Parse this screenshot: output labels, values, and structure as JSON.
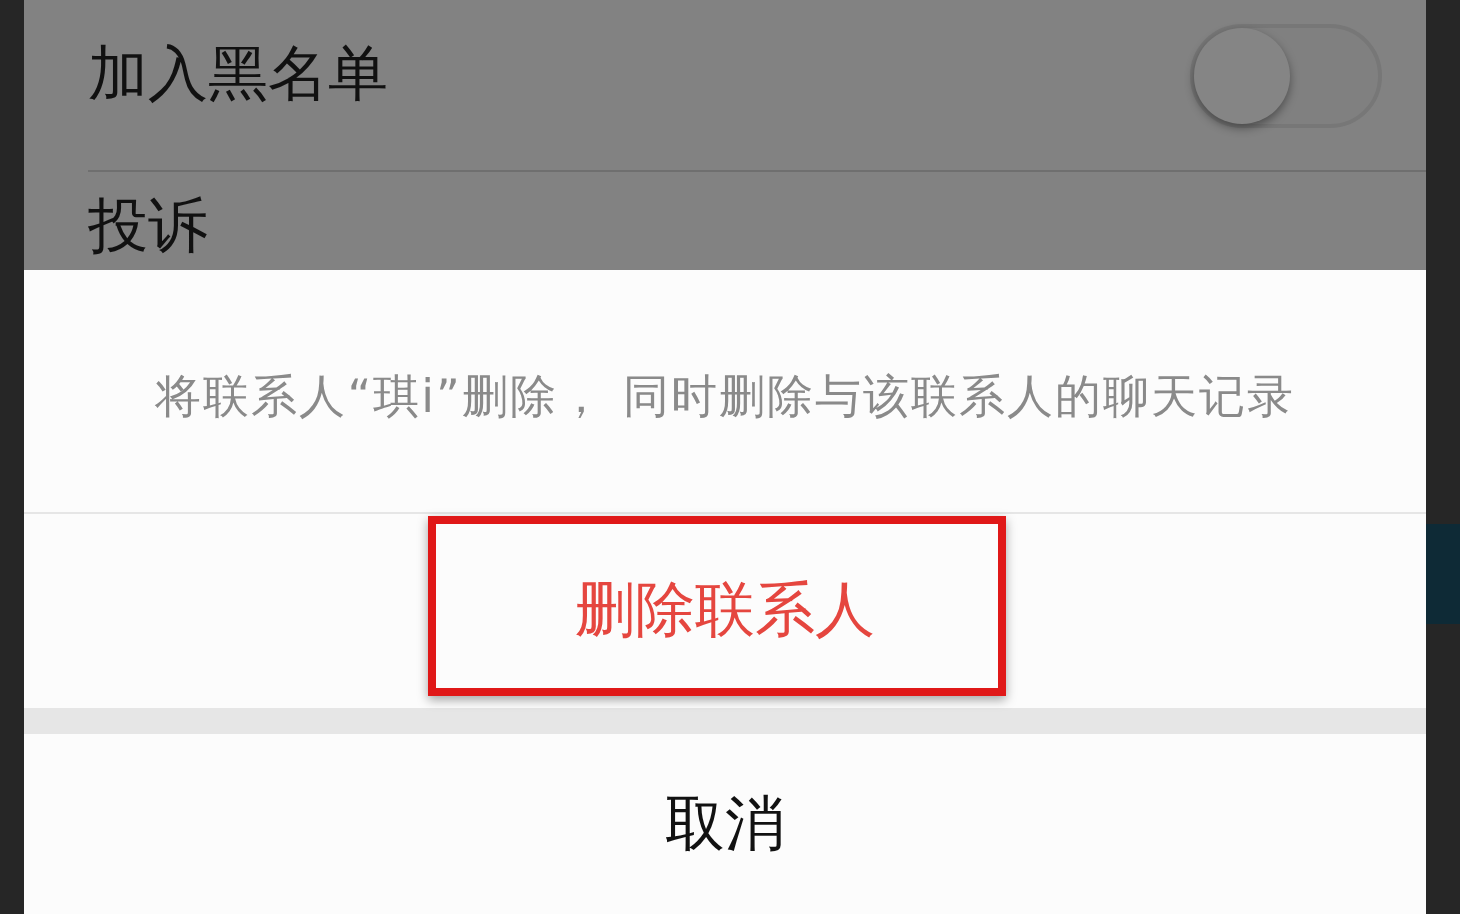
{
  "settings": [
    {
      "kind": "toggle",
      "label": "加入黑名单",
      "on": false
    },
    {
      "kind": "link",
      "label": "投诉"
    }
  ],
  "action_sheet": {
    "message": "将联系人“琪i”删除， 同时删除与该联系人的聊天记录",
    "actions": [
      {
        "label": "删除联系人",
        "kind": "destructive",
        "highlighted": true
      }
    ],
    "cancel": "取消"
  }
}
